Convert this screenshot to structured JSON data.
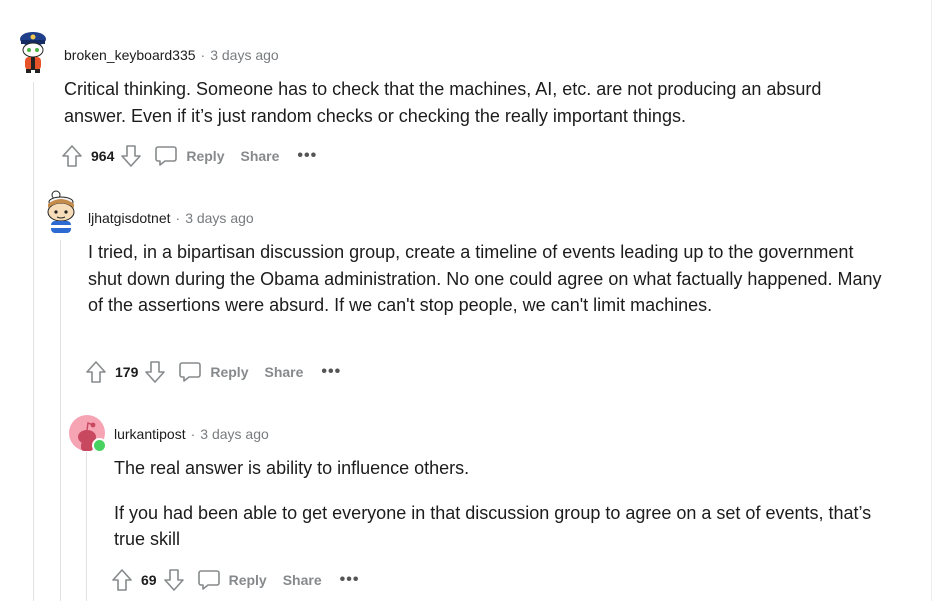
{
  "comments": [
    {
      "author": "broken_keyboard335",
      "separator": "·",
      "time": "3 days ago",
      "paragraphs": [
        "Critical thinking. Someone has to check that the machines, AI, etc. are not producing an absurd answer. Even if it’s just random checks or checking the really important things."
      ],
      "votes": "964",
      "reply_label": "Reply",
      "share_label": "Share",
      "more_label": "•••",
      "avatar_icon": "snoo-police-avatar"
    },
    {
      "author": "ljhatgisdotnet",
      "separator": "·",
      "time": "3 days ago",
      "paragraphs": [
        "I tried, in a bipartisan discussion group, create a timeline of events leading up to the government shut down during the Obama administration. No one could agree on what factually happened. Many of the assertions were absurd. If we can't stop people, we can't limit machines."
      ],
      "votes": "179",
      "reply_label": "Reply",
      "share_label": "Share",
      "more_label": "•••",
      "avatar_icon": "snoo-hat-avatar"
    },
    {
      "author": "lurkantipost",
      "separator": "·",
      "time": "3 days ago",
      "paragraphs": [
        "The real answer is ability to influence others.",
        "If you had been able to get everyone in that discussion group to agree on a set of events, that’s true skill"
      ],
      "votes": "69",
      "reply_label": "Reply",
      "share_label": "Share",
      "more_label": "•••",
      "avatar_icon": "default-snoo-avatar",
      "online": true
    }
  ],
  "colors": {
    "text": "#1c1c1c",
    "meta": "#787c7e",
    "action": "#878a8c",
    "online": "#46d160",
    "avatar_pink": "#f6a3b4"
  }
}
